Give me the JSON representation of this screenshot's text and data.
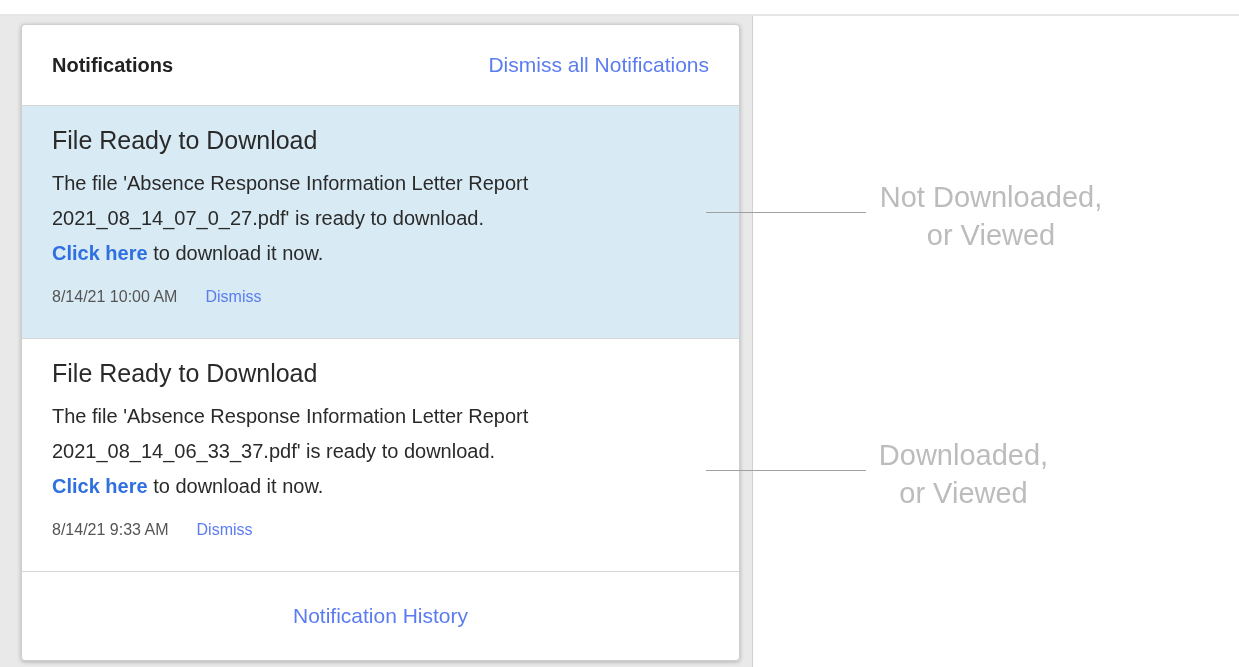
{
  "panel": {
    "title": "Notifications",
    "dismiss_all": "Dismiss all Notifications",
    "footer_link": "Notification History"
  },
  "notifications": [
    {
      "title": "File Ready to Download",
      "message": "The file 'Absence Response Information Letter Report 2021_08_14_07_0_27.pdf' is ready to download.",
      "link": "Click here",
      "link_suffix": "to download it now.",
      "time": "8/14/21 10:00 AM",
      "dismiss": "Dismiss",
      "viewed": false
    },
    {
      "title": "File Ready to Download",
      "message": "The file 'Absence Response Information Letter Report 2021_08_14_06_33_37.pdf' is ready to download.",
      "link": "Click here",
      "link_suffix": "to download it now.",
      "time": "8/14/21 9:33 AM",
      "dismiss": "Dismiss",
      "viewed": true
    }
  ],
  "annotations": [
    {
      "text": "Not Downloaded,\nor Viewed"
    },
    {
      "text": "Downloaded,\nor Viewed"
    }
  ]
}
